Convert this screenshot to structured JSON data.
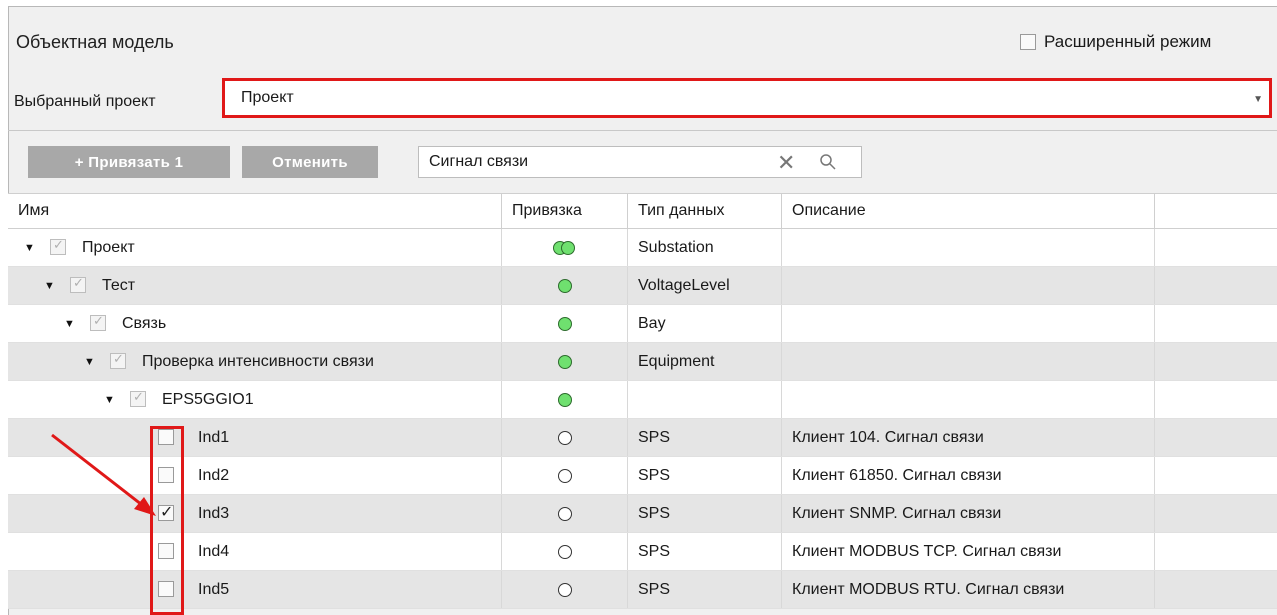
{
  "panel": {
    "title": "Объектная модель",
    "advanced_mode_label": "Расширенный режим",
    "project_label": "Выбранный проект",
    "project_value": "Проект"
  },
  "toolbar": {
    "bind_button": "+ Привязать 1",
    "cancel_button": "Отменить",
    "search_value": "Сигнал связи"
  },
  "columns": [
    "Имя",
    "Привязка",
    "Тип данных",
    "Описание"
  ],
  "rows": [
    {
      "name": "Проект",
      "type": "Substation",
      "desc": ""
    },
    {
      "name": "Тест",
      "type": "VoltageLevel",
      "desc": ""
    },
    {
      "name": "Связь",
      "type": "Bay",
      "desc": ""
    },
    {
      "name": "Проверка интенсивности связи",
      "type": "Equipment",
      "desc": ""
    },
    {
      "name": "EPS5GGIO1",
      "type": "",
      "desc": ""
    },
    {
      "name": "Ind1",
      "type": "SPS",
      "desc": "Клиент 104. Сигнал связи"
    },
    {
      "name": "Ind2",
      "type": "SPS",
      "desc": "Клиент 61850. Сигнал связи"
    },
    {
      "name": "Ind3",
      "type": "SPS",
      "desc": "Клиент SNMP. Сигнал связи"
    },
    {
      "name": "Ind4",
      "type": "SPS",
      "desc": "Клиент MODBUS TCP. Сигнал связи"
    },
    {
      "name": "Ind5",
      "type": "SPS",
      "desc": "Клиент MODBUS RTU. Сигнал связи"
    }
  ],
  "colors": {
    "highlight": "#e01818",
    "bound_green": "#6fe06f",
    "button_gray": "#a8a8a8"
  }
}
